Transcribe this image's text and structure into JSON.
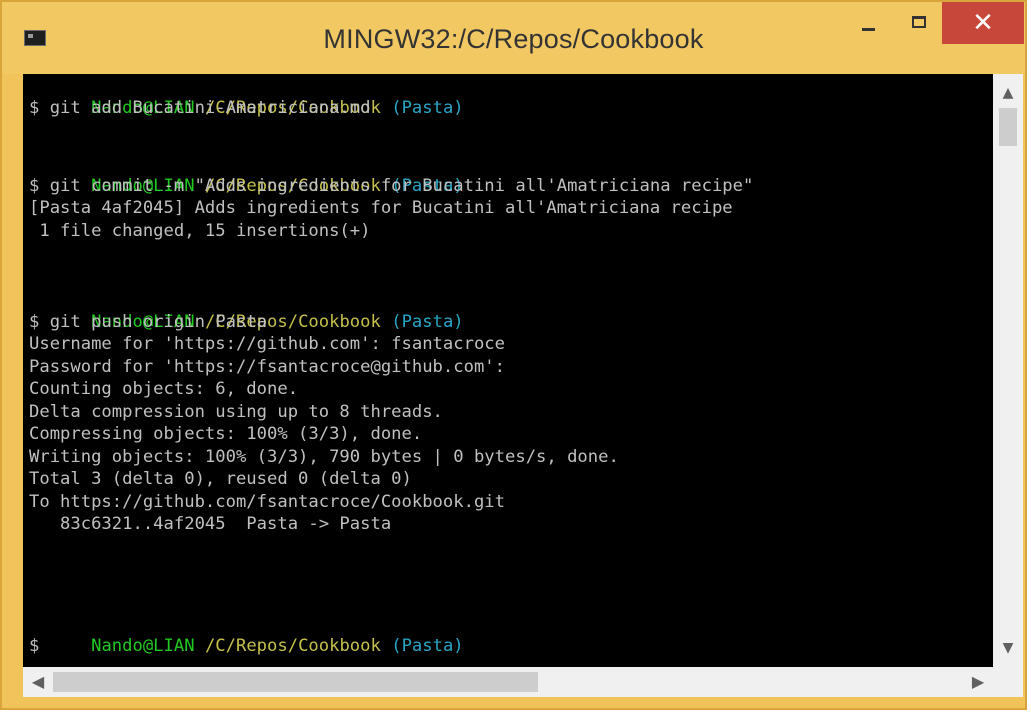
{
  "window": {
    "title": "MINGW32:/C/Repos/Cookbook",
    "minimize_label": "",
    "maximize_label": "",
    "close_label": "✕"
  },
  "prompt": {
    "user": "Nando@LIAN",
    "path": "/C/Repos/Cookbook",
    "branch": "(Pasta)"
  },
  "lines": [
    "$ git add Bucatini-Amatriciana.md",
    "$ git commit -m \"Adds ingredients for Bucatini all'Amatriciana recipe\"",
    "[Pasta 4af2045] Adds ingredients for Bucatini all'Amatriciana recipe",
    " 1 file changed, 15 insertions(+)",
    "$ git push origin Pasta",
    "Username for 'https://github.com': fsantacroce",
    "Password for 'https://fsantacroce@github.com':",
    "Counting objects: 6, done.",
    "Delta compression using up to 8 threads.",
    "Compressing objects: 100% (3/3), done.",
    "Writing objects: 100% (3/3), 790 bytes | 0 bytes/s, done.",
    "Total 3 (delta 0), reused 0 (delta 0)",
    "To https://github.com/fsantacroce/Cookbook.git",
    "   83c6321..4af2045  Pasta -> Pasta",
    "$"
  ],
  "scroll_icons": {
    "up": "▲",
    "down": "▼",
    "left": "◀",
    "right": "▶"
  },
  "colors": {
    "user": "#22c922",
    "path": "#c4c04b",
    "branch": "#2aa6c5",
    "text": "#c0c0c0",
    "titlebar": "#f2c862",
    "close_button": "#c7483a"
  }
}
